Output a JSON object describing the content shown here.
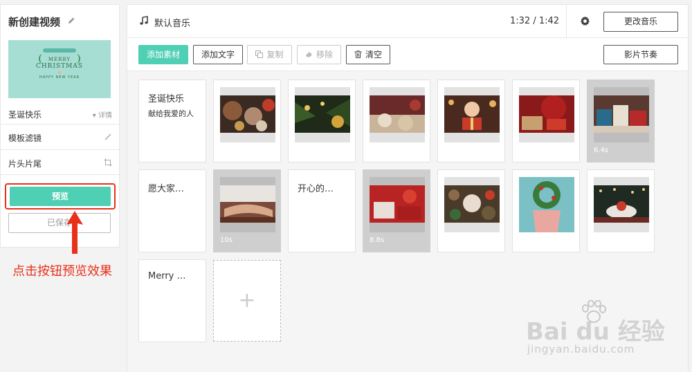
{
  "sidebar": {
    "project_title": "新创建视频",
    "thumbnail_text": {
      "line1": "MERRY",
      "line2": "CHRISTMAS",
      "line3": "HAPPY NEW YEAR"
    },
    "template_name": "圣诞快乐",
    "detail_label": "详情",
    "filter_label": "模板滤镜",
    "intro_outro_label": "片头片尾",
    "preview_label": "预览",
    "saved_label": "已保存"
  },
  "annotation": "点击按钮预览效果",
  "header": {
    "music_name": "默认音乐",
    "time": "1:32 / 1:42",
    "change_music_label": "更改音乐"
  },
  "toolbar": {
    "add_material": "添加素材",
    "add_text": "添加文字",
    "copy": "复制",
    "move": "移除",
    "clear": "清空",
    "rhythm": "影片节奏"
  },
  "cards": [
    {
      "type": "text",
      "line1": "圣诞快乐",
      "line2": "献给我爱的人"
    },
    {
      "type": "image",
      "scene": "ornaments"
    },
    {
      "type": "image",
      "scene": "tree-bauble"
    },
    {
      "type": "image",
      "scene": "cookies"
    },
    {
      "type": "image",
      "scene": "child-gift"
    },
    {
      "type": "image",
      "scene": "red-gifts"
    },
    {
      "type": "image",
      "scene": "presents",
      "duration": "6.4s"
    },
    {
      "type": "text",
      "line1": "愿大家…",
      "line2": ""
    },
    {
      "type": "image",
      "scene": "hands",
      "duration": "10s"
    },
    {
      "type": "text",
      "line1": "开心的…",
      "line2": ""
    },
    {
      "type": "image",
      "scene": "gift-box",
      "duration": "8.8s"
    },
    {
      "type": "image",
      "scene": "pinecones"
    },
    {
      "type": "image",
      "scene": "wreath-door"
    },
    {
      "type": "image",
      "scene": "table-lights"
    },
    {
      "type": "text",
      "line1": "Merry …",
      "line2": ""
    }
  ],
  "add_label": "+",
  "watermark": {
    "brand": "Bai du 经验",
    "url": "jingyan.baidu.com"
  },
  "colors": {
    "accent": "#4fcfb4",
    "annotation_red": "#e8301a"
  }
}
